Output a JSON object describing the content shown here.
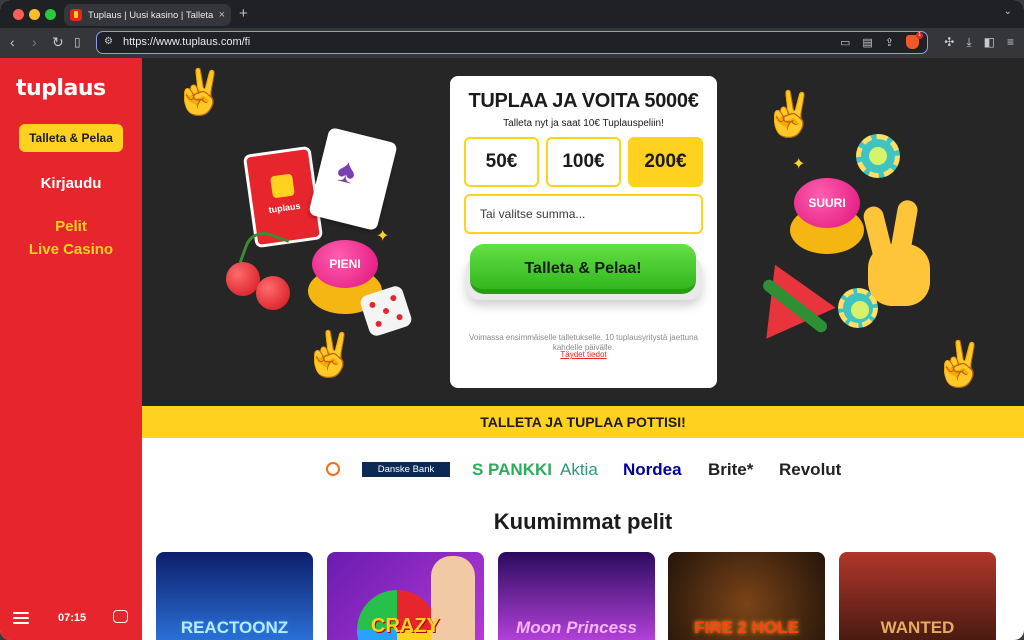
{
  "browser": {
    "tab_title": "Tuplaus | Uusi kasino | Talleta",
    "url": "https://www.tuplaus.com/fi",
    "new_tab": "+",
    "tab_close": "×"
  },
  "sidebar": {
    "logo": "tuplaus",
    "cta": "Talleta & Pelaa",
    "login": "Kirjaudu",
    "links": [
      "Pelit",
      "Live Casino"
    ],
    "time": "07:15"
  },
  "hero": {
    "title": "TUPLAA JA VOITA 5000€",
    "subtitle": "Talleta nyt ja saat 10€ Tuplauspeliin!",
    "amounts": [
      {
        "label": "50€",
        "selected": false
      },
      {
        "label": "100€",
        "selected": false
      },
      {
        "label": "200€",
        "selected": true
      }
    ],
    "amount_placeholder": "Tai valitse summa...",
    "cta": "Talleta & Pelaa!",
    "note": "Voimassa ensimmäiselle talletukselle. 10 tuplausyritystä jaettuna kahdelle päivälle.",
    "terms_link": "Täydet tiedot",
    "button_left": "PIENI",
    "button_right": "SUURI",
    "card_brand": "tuplaus"
  },
  "strip": "TALLETA JA TUPLAA POTTISI!",
  "banks": [
    "Danske Bank",
    "S PANKKI",
    "Aktia",
    "Nordea",
    "Brite*",
    "Revolut"
  ],
  "games_title": "Kuumimmat pelit",
  "games": [
    "REACTOONZ",
    "CRAZY",
    "Moon Princess",
    "FIRE 2 HOLE",
    "WANTED"
  ],
  "colors": {
    "brand_red": "#e6252d",
    "brand_yellow": "#ffd21f",
    "cta_green": "#3cc52a",
    "hero_bg": "#262626"
  }
}
